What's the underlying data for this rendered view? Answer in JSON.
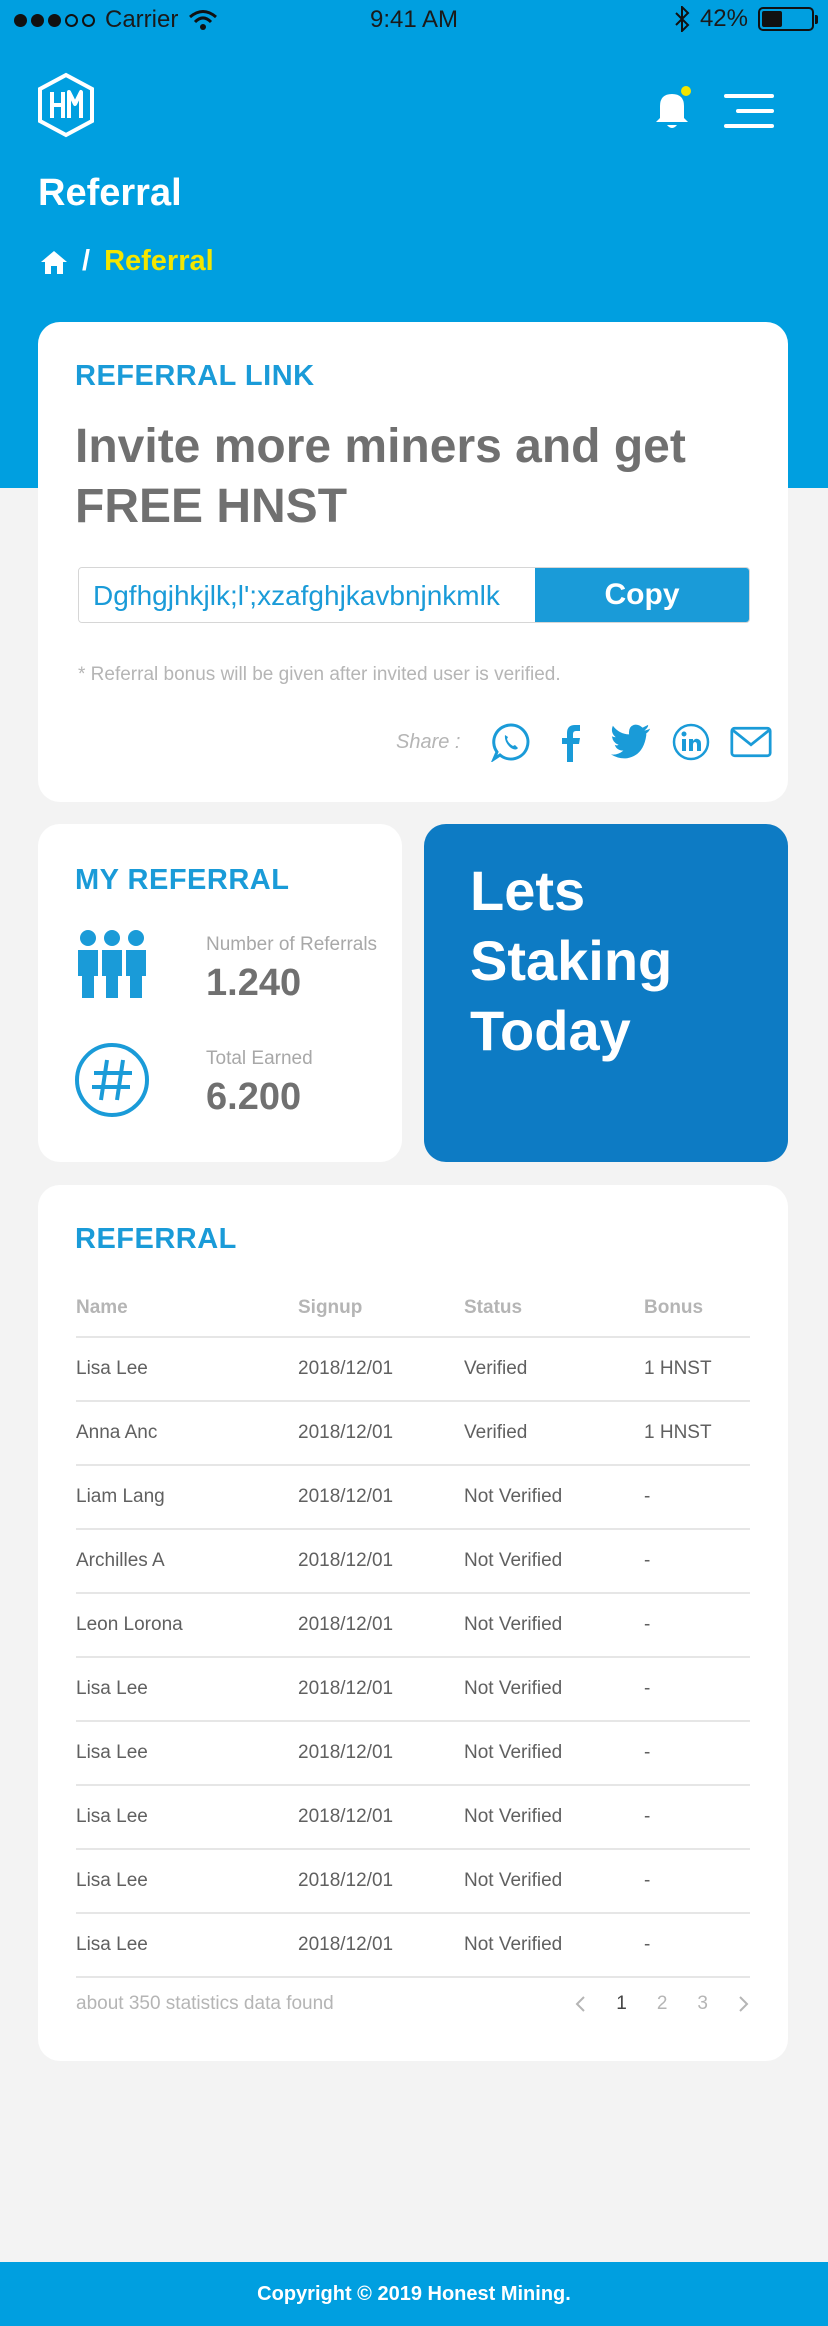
{
  "status_bar": {
    "carrier": "Carrier",
    "time": "9:41 AM",
    "battery": "42%",
    "battery_level": 0.42
  },
  "header": {
    "title": "Referral",
    "breadcrumb_current": "Referral",
    "notification_dot_color": "#f3e600"
  },
  "referral_link": {
    "heading": "REFERRAL LINK",
    "headline": "Invite more miners and get FREE HNST",
    "link_value": "Dgfhgjhkjlk;l';xzafghjkavbnjnkmlk",
    "copy_label": "Copy",
    "note": "* Referral bonus will be given after invited user is verified.",
    "share_label": "Share :"
  },
  "my_referral": {
    "heading": "MY REFERRAL",
    "referrals_label": "Number of Referrals",
    "referrals_value": "1.240",
    "earned_label": "Total Earned",
    "earned_value": "6.200"
  },
  "promo": {
    "text": "Lets Staking Today"
  },
  "referral_table": {
    "heading": "REFERRAL",
    "columns": [
      "Name",
      "Signup",
      "Status",
      "Bonus"
    ],
    "rows": [
      {
        "name": "Lisa Lee",
        "signup": "2018/12/01",
        "status": "Verified",
        "bonus": "1 HNST"
      },
      {
        "name": "Anna Anc",
        "signup": "2018/12/01",
        "status": "Verified",
        "bonus": "1 HNST"
      },
      {
        "name": "Liam Lang",
        "signup": "2018/12/01",
        "status": "Not Verified",
        "bonus": "-"
      },
      {
        "name": "Archilles A",
        "signup": "2018/12/01",
        "status": "Not Verified",
        "bonus": "-"
      },
      {
        "name": "Leon Lorona",
        "signup": "2018/12/01",
        "status": "Not Verified",
        "bonus": "-"
      },
      {
        "name": "Lisa Lee",
        "signup": "2018/12/01",
        "status": "Not Verified",
        "bonus": "-"
      },
      {
        "name": "Lisa Lee",
        "signup": "2018/12/01",
        "status": "Not Verified",
        "bonus": "-"
      },
      {
        "name": "Lisa Lee",
        "signup": "2018/12/01",
        "status": "Not Verified",
        "bonus": "-"
      },
      {
        "name": "Lisa Lee",
        "signup": "2018/12/01",
        "status": "Not Verified",
        "bonus": "-"
      },
      {
        "name": "Lisa Lee",
        "signup": "2018/12/01",
        "status": "Not Verified",
        "bonus": "-"
      }
    ],
    "summary": "about 350 statistics data found",
    "pages": [
      "1",
      "2",
      "3"
    ],
    "current_page": "1"
  },
  "footer": {
    "copyright": "Copyright © 2019 Honest Mining."
  },
  "colors": {
    "brand_blue": "#009fe0",
    "accent_blue": "#1a9bd8",
    "promo_blue": "#0d7bc4",
    "breadcrumb_active": "#f3e600"
  },
  "icons": [
    "signal-dots-icon",
    "wifi-icon",
    "bluetooth-icon",
    "battery-icon",
    "hm-logo-icon",
    "bell-icon",
    "hamburger-menu-icon",
    "home-icon",
    "whatsapp-icon",
    "facebook-icon",
    "twitter-icon",
    "linkedin-icon",
    "mail-icon",
    "people-icon",
    "hash-icon",
    "chevron-left-icon",
    "chevron-right-icon"
  ]
}
